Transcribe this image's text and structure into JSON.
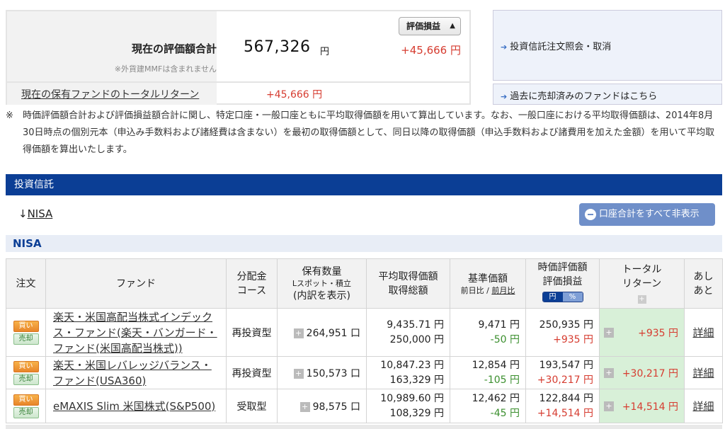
{
  "summary": {
    "label": "現在の評価額合計",
    "note": "※外貨建MMFは含まれません",
    "value": "567,326",
    "yen": "円",
    "gain": "+45,666 円",
    "select_value": "評価損益",
    "total_return_label": "現在の保有ファンドのトータルリターン",
    "total_return_value": "+45,666 円"
  },
  "panel": {
    "link1": "投資信託注文照会・取消",
    "link2": "過去に売却済みのファンドはこちら"
  },
  "disclaimer": {
    "mark": "※",
    "text": "時価評価額合計および評価損益額合計に関し、特定口座・一般口座ともに平均取得価額を用いて算出しています。なお、一般口座における平均取得価額は、2014年8月30日時点の個別元本（申込み手数料および諸経費は含まない）を最初の取得価額として、同日以降の取得価額（申込手数料および諸費用を加えた金額）を用いて平均取得価額を算出いたします。"
  },
  "section": {
    "title": "投資信託",
    "anchor_arrow": "↓",
    "anchor_label": "NISA",
    "hide_button": "口座合計をすべて非表示",
    "nisa_label": "NISA"
  },
  "table": {
    "headers": {
      "order": "注文",
      "fund": "ファンド",
      "dist1": "分配金",
      "dist2": "コース",
      "qty1": "保有数量",
      "qty_sub": "Lスポット・積立",
      "qty2": "(内訳を表示)",
      "avg1": "平均取得価額",
      "avg2": "取得総額",
      "base1": "基準価額",
      "base_sub1": "前日比",
      "base_sep": " / ",
      "base_sub2": "前月比",
      "val1": "時価評価額",
      "val2": "評価損益",
      "pill_yen": "円",
      "pill_pct": "%",
      "tr1": "トータル",
      "tr2": "リターン",
      "tr_plus": "+",
      "hist1": "あし",
      "hist2": "あと"
    },
    "buy_label": "買い",
    "sell_label": "売却",
    "plus": "+",
    "detail_label": "詳細",
    "rows": [
      {
        "fund": "楽天・米国高配当株式インデックス・ファンド(楽天・バンガード・ファンド(米国高配当株式))",
        "course": "再投資型",
        "qty": "264,951 口",
        "avg_price": "9,435.71 円",
        "avg_total": "250,000 円",
        "base_price": "9,471 円",
        "base_change": "-50 円",
        "market_value": "250,935 円",
        "gain": "+935 円",
        "total_return": "+935 円"
      },
      {
        "fund": "楽天・米国レバレッジバランス・ファンド(USA360)",
        "course": "再投資型",
        "qty": "150,573 口",
        "avg_price": "10,847.23 円",
        "avg_total": "163,329 円",
        "base_price": "12,854 円",
        "base_change": "-105 円",
        "market_value": "193,547 円",
        "gain": "+30,217 円",
        "total_return": "+30,217 円"
      },
      {
        "fund": "eMAXIS Slim 米国株式(S&P500)",
        "course": "受取型",
        "qty": "98,575 口",
        "avg_price": "10,989.60 円",
        "avg_total": "108,329 円",
        "base_price": "12,462 円",
        "base_change": "-45 円",
        "market_value": "122,844 円",
        "gain": "+14,514 円",
        "total_return": "+14,514 円"
      }
    ]
  },
  "colors": {
    "navy": "#0b3e95",
    "gain_red": "#d63c30",
    "loss_green": "#3b8f2e",
    "return_bg": "#d8f0d8"
  }
}
